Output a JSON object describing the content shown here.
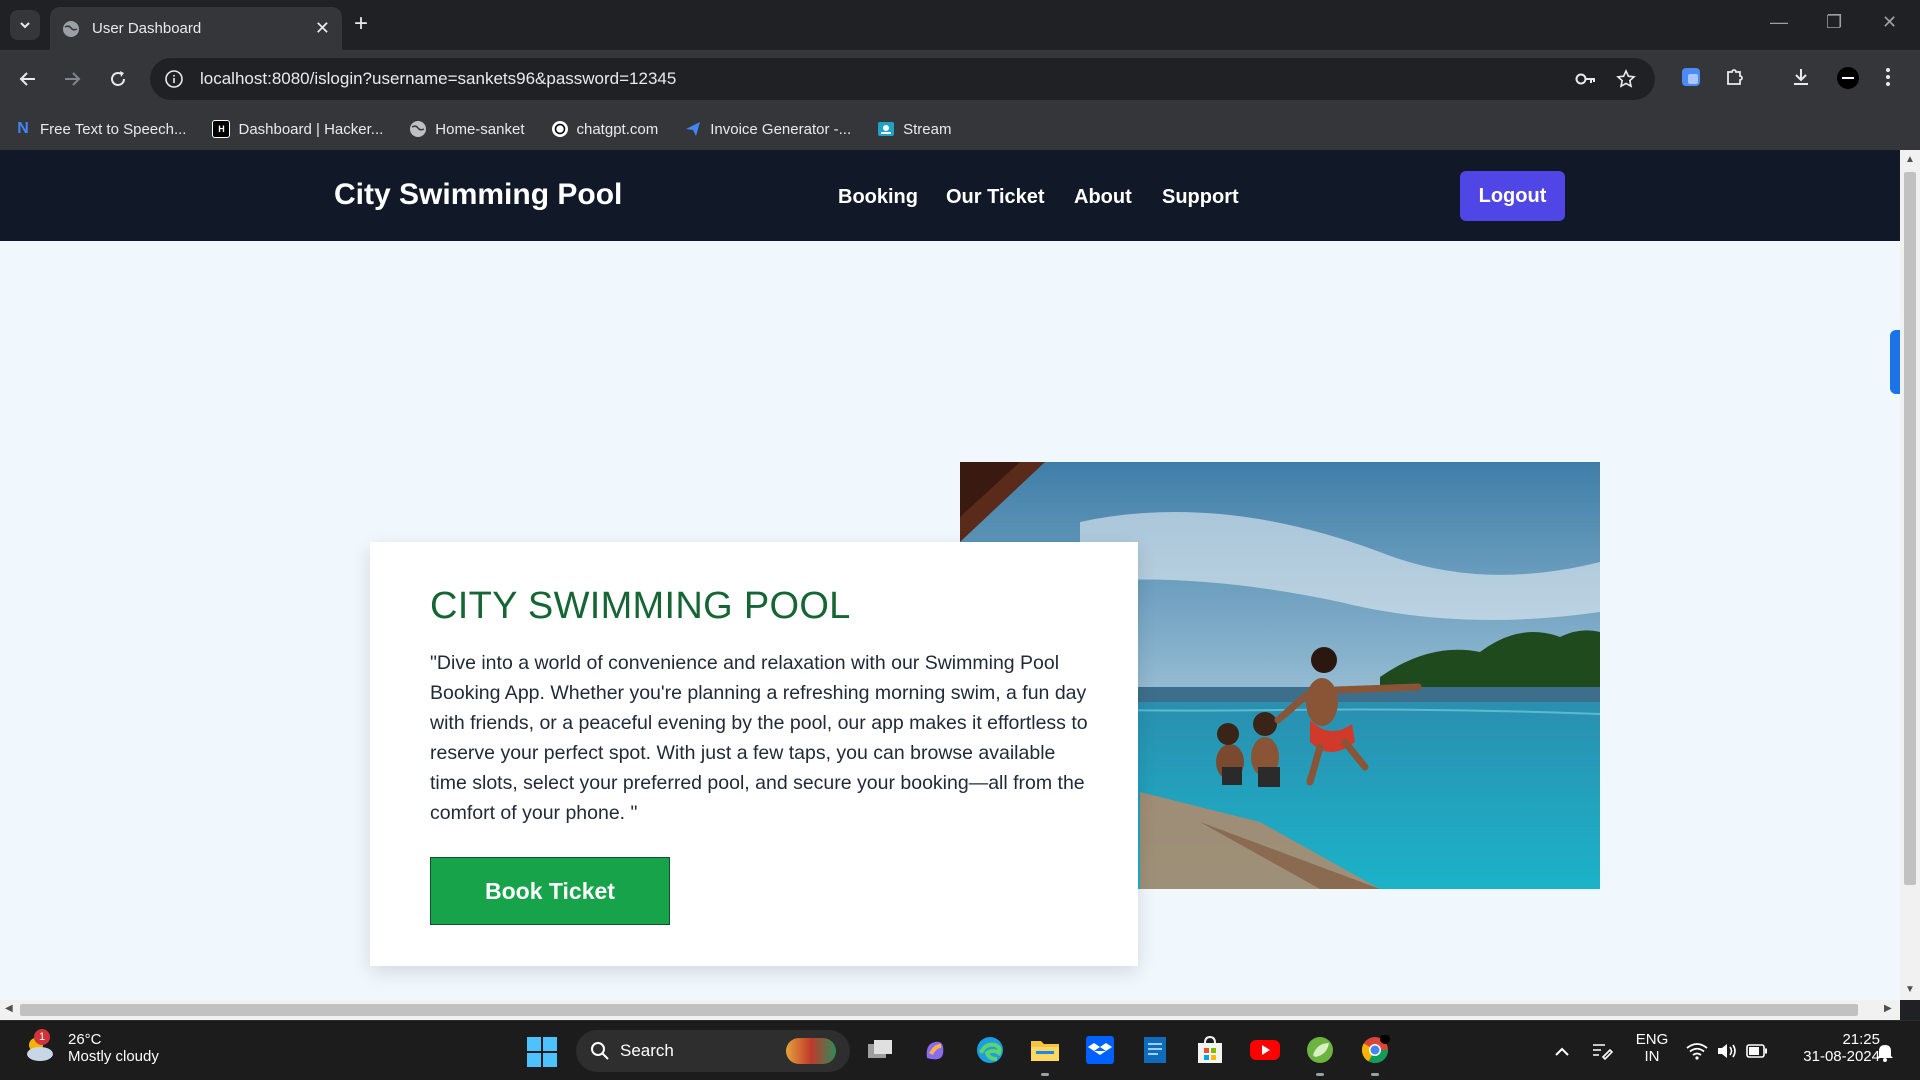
{
  "browser": {
    "tab_title": "User Dashboard",
    "url": "localhost:8080/islogin?username=sankets96&password=12345",
    "bookmarks": [
      {
        "label": "Free Text to Speech...",
        "icon": "n-blue-icon"
      },
      {
        "label": "Dashboard | Hacker...",
        "icon": "hackerrank-icon"
      },
      {
        "label": "Home-sanket",
        "icon": "globe-icon"
      },
      {
        "label": "chatgpt.com",
        "icon": "chatgpt-icon"
      },
      {
        "label": "Invoice Generator -...",
        "icon": "paper-plane-icon"
      },
      {
        "label": "Stream",
        "icon": "stream-icon"
      }
    ]
  },
  "site": {
    "brand": "City Swimming Pool",
    "nav": [
      "Booking",
      "Our Ticket",
      "About",
      "Support"
    ],
    "logout_label": "Logout",
    "accent": "#4f46e5"
  },
  "hero": {
    "heading": "CITY SWIMMING POOL",
    "description": "\"Dive into a world of convenience and relaxation with our Swimming Pool Booking App. Whether you're planning a refreshing morning swim, a fun day with friends, or a peaceful evening by the pool, our app makes it effortless to reserve your perfect spot. With just a few taps, you can browse available time slots, select your preferred pool, and secure your booking—all from the comfort of your phone. \"",
    "button_label": "Book Ticket",
    "heading_color": "#166534",
    "button_color": "#16a34a"
  },
  "taskbar": {
    "temperature": "26°C",
    "condition": "Mostly cloudy",
    "weather_badge": "1",
    "search_label": "Search",
    "language": "ENG",
    "region": "IN",
    "time": "21:25",
    "date": "31-08-2024"
  }
}
